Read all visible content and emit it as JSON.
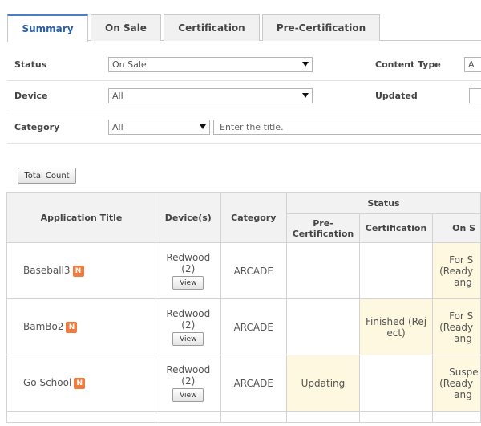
{
  "tabs": [
    {
      "label": "Summary"
    },
    {
      "label": "On Sale"
    },
    {
      "label": "Certification"
    },
    {
      "label": "Pre-Certification"
    }
  ],
  "filters": {
    "status_label": "Status",
    "status_value": "On Sale",
    "content_type_label": "Content Type",
    "content_type_value": "A",
    "device_label": "Device",
    "device_value": "All",
    "updated_label": "Updated",
    "category_label": "Category",
    "category_value": "All",
    "title_placeholder": "Enter the title."
  },
  "total_count_label": "Total Count",
  "table": {
    "headers": {
      "app_title": "Application Title",
      "devices": "Device(s)",
      "category": "Category",
      "status": "Status",
      "precert": "Pre-Certification",
      "cert": "Certification",
      "onsale": "On S"
    },
    "rows": [
      {
        "title": "Baseball3",
        "badge": "N",
        "device_name": "Redwood",
        "device_count": "(2)",
        "view_label": "View",
        "category": "ARCADE",
        "precert": "",
        "cert": "",
        "onsale": [
          "For S",
          "(Ready",
          "ang"
        ]
      },
      {
        "title": "BamBo2",
        "badge": "N",
        "device_name": "Redwood",
        "device_count": "(2)",
        "view_label": "View",
        "category": "ARCADE",
        "precert": "",
        "cert": [
          "Finished (Rej",
          "ect)"
        ],
        "onsale": [
          "For S",
          "(Ready",
          "ang"
        ]
      },
      {
        "title": "Go School",
        "badge": "N",
        "device_name": "Redwood",
        "device_count": "(2)",
        "view_label": "View",
        "category": "ARCADE",
        "precert": "Updating",
        "cert": "",
        "onsale": [
          "Suspe",
          "(Ready",
          "ang"
        ]
      }
    ]
  },
  "colors": {
    "active_tab_text": "#2a5fa8",
    "new_badge": "#f07b3e",
    "highlight_cell": "#fdf8df"
  },
  "icons": {
    "new_badge": "new-badge-icon",
    "dropdown": "chevron-down-icon"
  }
}
